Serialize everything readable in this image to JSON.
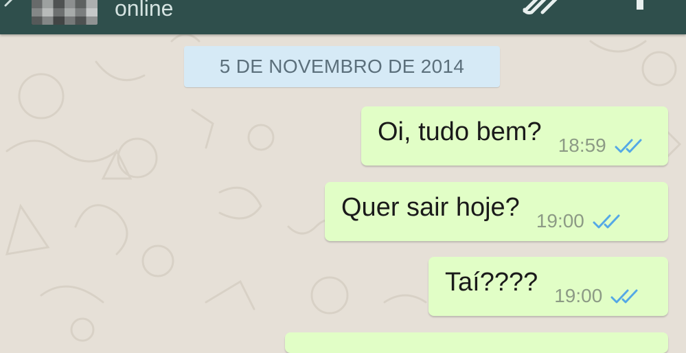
{
  "header": {
    "status": "online",
    "colors": {
      "bar": "#2f4f4c",
      "status_text": "#d5e3e1"
    }
  },
  "icons": {
    "back": "back-arrow-icon",
    "avatar": "contact-avatar",
    "attach": "paperclip-icon",
    "menu": "overflow-menu-icon",
    "read": "double-check-icon"
  },
  "date_divider": {
    "label": "5 DE NOVEMBRO DE 2014"
  },
  "messages": [
    {
      "text": "Oi, tudo bem?",
      "time": "18:59",
      "status": "read"
    },
    {
      "text": "Quer sair hoje?",
      "time": "19:00",
      "status": "read"
    },
    {
      "text": "Taí????",
      "time": "19:00",
      "status": "read"
    },
    {
      "text": "",
      "time": "",
      "status": "partial"
    }
  ],
  "colors": {
    "chat_background": "#e6e0d7",
    "outgoing_bubble": "#e1fec6",
    "date_chip": "#d6eaf6",
    "read_ticks": "#54a8e6"
  }
}
